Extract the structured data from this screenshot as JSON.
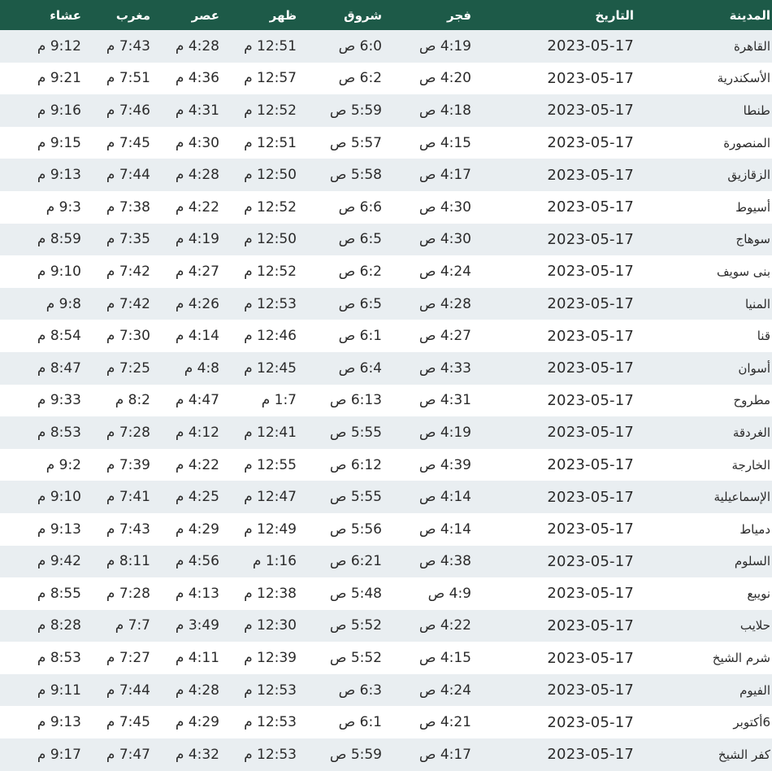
{
  "table": {
    "headers": {
      "city": "المدينة",
      "date": "التاريخ",
      "fajr": "فجر",
      "sunrise": "شروق",
      "dhuhr": "ظهر",
      "asr": "عصر",
      "maghrib": "مغرب",
      "isha": "عشاء"
    },
    "rows": [
      {
        "city": "القاهرة",
        "date": "2023-05-17",
        "fajr": "4:19 ص",
        "sunrise": "6:0 ص",
        "dhuhr": "12:51 م",
        "asr": "4:28 م",
        "maghrib": "7:43 م",
        "isha": "9:12 م"
      },
      {
        "city": "الأسكندرية",
        "date": "2023-05-17",
        "fajr": "4:20 ص",
        "sunrise": "6:2 ص",
        "dhuhr": "12:57 م",
        "asr": "4:36 م",
        "maghrib": "7:51 م",
        "isha": "9:21 م"
      },
      {
        "city": "طنطا",
        "date": "2023-05-17",
        "fajr": "4:18 ص",
        "sunrise": "5:59 ص",
        "dhuhr": "12:52 م",
        "asr": "4:31 م",
        "maghrib": "7:46 م",
        "isha": "9:16 م"
      },
      {
        "city": "المنصورة",
        "date": "2023-05-17",
        "fajr": "4:15 ص",
        "sunrise": "5:57 ص",
        "dhuhr": "12:51 م",
        "asr": "4:30 م",
        "maghrib": "7:45 م",
        "isha": "9:15 م"
      },
      {
        "city": "الزقازيق",
        "date": "2023-05-17",
        "fajr": "4:17 ص",
        "sunrise": "5:58 ص",
        "dhuhr": "12:50 م",
        "asr": "4:28 م",
        "maghrib": "7:44 م",
        "isha": "9:13 م"
      },
      {
        "city": "أسيوط",
        "date": "2023-05-17",
        "fajr": "4:30 ص",
        "sunrise": "6:6 ص",
        "dhuhr": "12:52 م",
        "asr": "4:22 م",
        "maghrib": "7:38 م",
        "isha": "9:3 م"
      },
      {
        "city": "سوهاج",
        "date": "2023-05-17",
        "fajr": "4:30 ص",
        "sunrise": "6:5 ص",
        "dhuhr": "12:50 م",
        "asr": "4:19 م",
        "maghrib": "7:35 م",
        "isha": "8:59 م"
      },
      {
        "city": "بنى سويف",
        "date": "2023-05-17",
        "fajr": "4:24 ص",
        "sunrise": "6:2 ص",
        "dhuhr": "12:52 م",
        "asr": "4:27 م",
        "maghrib": "7:42 م",
        "isha": "9:10 م"
      },
      {
        "city": "المنيا",
        "date": "2023-05-17",
        "fajr": "4:28 ص",
        "sunrise": "6:5 ص",
        "dhuhr": "12:53 م",
        "asr": "4:26 م",
        "maghrib": "7:42 م",
        "isha": "9:8 م"
      },
      {
        "city": "قنا",
        "date": "2023-05-17",
        "fajr": "4:27 ص",
        "sunrise": "6:1 ص",
        "dhuhr": "12:46 م",
        "asr": "4:14 م",
        "maghrib": "7:30 م",
        "isha": "8:54 م"
      },
      {
        "city": "أسوان",
        "date": "2023-05-17",
        "fajr": "4:33 ص",
        "sunrise": "6:4 ص",
        "dhuhr": "12:45 م",
        "asr": "4:8 م",
        "maghrib": "7:25 م",
        "isha": "8:47 م"
      },
      {
        "city": "مطروح",
        "date": "2023-05-17",
        "fajr": "4:31 ص",
        "sunrise": "6:13 ص",
        "dhuhr": "1:7 م",
        "asr": "4:47 م",
        "maghrib": "8:2 م",
        "isha": "9:33 م"
      },
      {
        "city": "الغردقة",
        "date": "2023-05-17",
        "fajr": "4:19 ص",
        "sunrise": "5:55 ص",
        "dhuhr": "12:41 م",
        "asr": "4:12 م",
        "maghrib": "7:28 م",
        "isha": "8:53 م"
      },
      {
        "city": "الخارجة",
        "date": "2023-05-17",
        "fajr": "4:39 ص",
        "sunrise": "6:12 ص",
        "dhuhr": "12:55 م",
        "asr": "4:22 م",
        "maghrib": "7:39 م",
        "isha": "9:2 م"
      },
      {
        "city": "الإسماعيلية",
        "date": "2023-05-17",
        "fajr": "4:14 ص",
        "sunrise": "5:55 ص",
        "dhuhr": "12:47 م",
        "asr": "4:25 م",
        "maghrib": "7:41 م",
        "isha": "9:10 م"
      },
      {
        "city": "دمياط",
        "date": "2023-05-17",
        "fajr": "4:14 ص",
        "sunrise": "5:56 ص",
        "dhuhr": "12:49 م",
        "asr": "4:29 م",
        "maghrib": "7:43 م",
        "isha": "9:13 م"
      },
      {
        "city": "السلوم",
        "date": "2023-05-17",
        "fajr": "4:38 ص",
        "sunrise": "6:21 ص",
        "dhuhr": "1:16 م",
        "asr": "4:56 م",
        "maghrib": "8:11 م",
        "isha": "9:42 م"
      },
      {
        "city": "نويبع",
        "date": "2023-05-17",
        "fajr": "4:9 ص",
        "sunrise": "5:48 ص",
        "dhuhr": "12:38 م",
        "asr": "4:13 م",
        "maghrib": "7:28 م",
        "isha": "8:55 م"
      },
      {
        "city": "حلايب",
        "date": "2023-05-17",
        "fajr": "4:22 ص",
        "sunrise": "5:52 ص",
        "dhuhr": "12:30 م",
        "asr": "3:49 م",
        "maghrib": "7:7 م",
        "isha": "8:28 م"
      },
      {
        "city": "شرم الشيخ",
        "date": "2023-05-17",
        "fajr": "4:15 ص",
        "sunrise": "5:52 ص",
        "dhuhr": "12:39 م",
        "asr": "4:11 م",
        "maghrib": "7:27 م",
        "isha": "8:53 م"
      },
      {
        "city": "الفيوم",
        "date": "2023-05-17",
        "fajr": "4:24 ص",
        "sunrise": "6:3 ص",
        "dhuhr": "12:53 م",
        "asr": "4:28 م",
        "maghrib": "7:44 م",
        "isha": "9:11 م"
      },
      {
        "city": "6أكتوبر",
        "date": "2023-05-17",
        "fajr": "4:21 ص",
        "sunrise": "6:1 ص",
        "dhuhr": "12:53 م",
        "asr": "4:29 م",
        "maghrib": "7:45 م",
        "isha": "9:13 م"
      },
      {
        "city": "كفر الشيخ",
        "date": "2023-05-17",
        "fajr": "4:17 ص",
        "sunrise": "5:59 ص",
        "dhuhr": "12:53 م",
        "asr": "4:32 م",
        "maghrib": "7:47 م",
        "isha": "9:17 م"
      }
    ]
  }
}
